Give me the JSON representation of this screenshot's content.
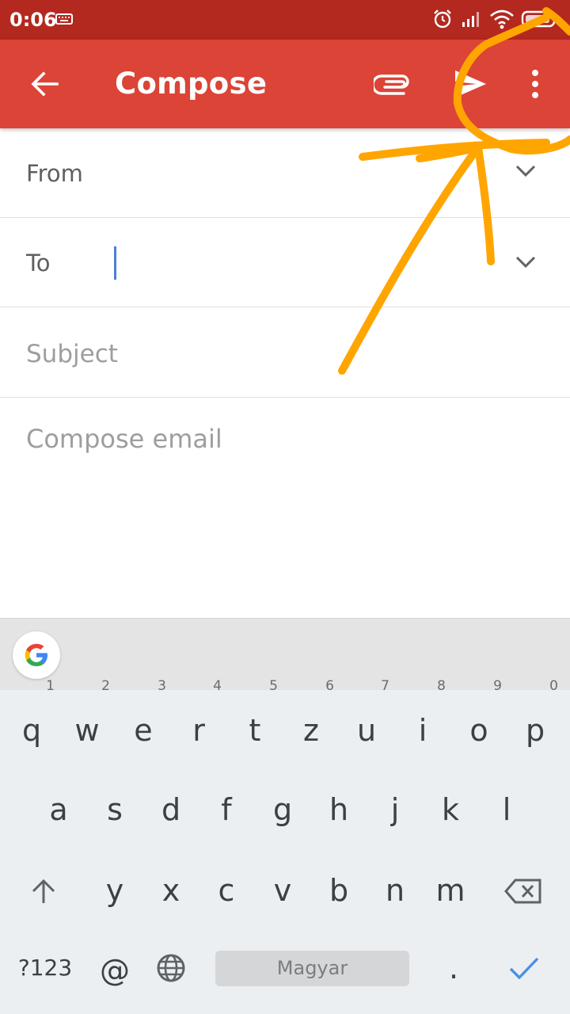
{
  "status_bar": {
    "time": "0:06",
    "icons": [
      "keyboard-icon",
      "alarm-icon",
      "signal-icon",
      "wifi-icon",
      "battery-icon"
    ]
  },
  "app_bar": {
    "title": "Compose",
    "background": "#db4437",
    "actions": [
      "attach-icon",
      "send-icon",
      "more-vert-icon"
    ]
  },
  "form": {
    "from_label": "From",
    "to_label": "To",
    "subject_placeholder": "Subject",
    "body_placeholder": "Compose email"
  },
  "keyboard": {
    "row1": [
      {
        "key": "q",
        "hint": "1"
      },
      {
        "key": "w",
        "hint": "2"
      },
      {
        "key": "e",
        "hint": "3"
      },
      {
        "key": "r",
        "hint": "4"
      },
      {
        "key": "t",
        "hint": "5"
      },
      {
        "key": "z",
        "hint": "6"
      },
      {
        "key": "u",
        "hint": "7"
      },
      {
        "key": "i",
        "hint": "8"
      },
      {
        "key": "o",
        "hint": "9"
      },
      {
        "key": "p",
        "hint": "0"
      }
    ],
    "row2": [
      "a",
      "s",
      "d",
      "f",
      "g",
      "h",
      "j",
      "k",
      "l"
    ],
    "row3": [
      "y",
      "x",
      "c",
      "v",
      "b",
      "n",
      "m"
    ],
    "symbols_label": "?123",
    "at_label": "@",
    "space_label": "Magyar",
    "period_label": ".",
    "accent_color": "#4a90e2"
  },
  "annotation_color": "#ffa500"
}
